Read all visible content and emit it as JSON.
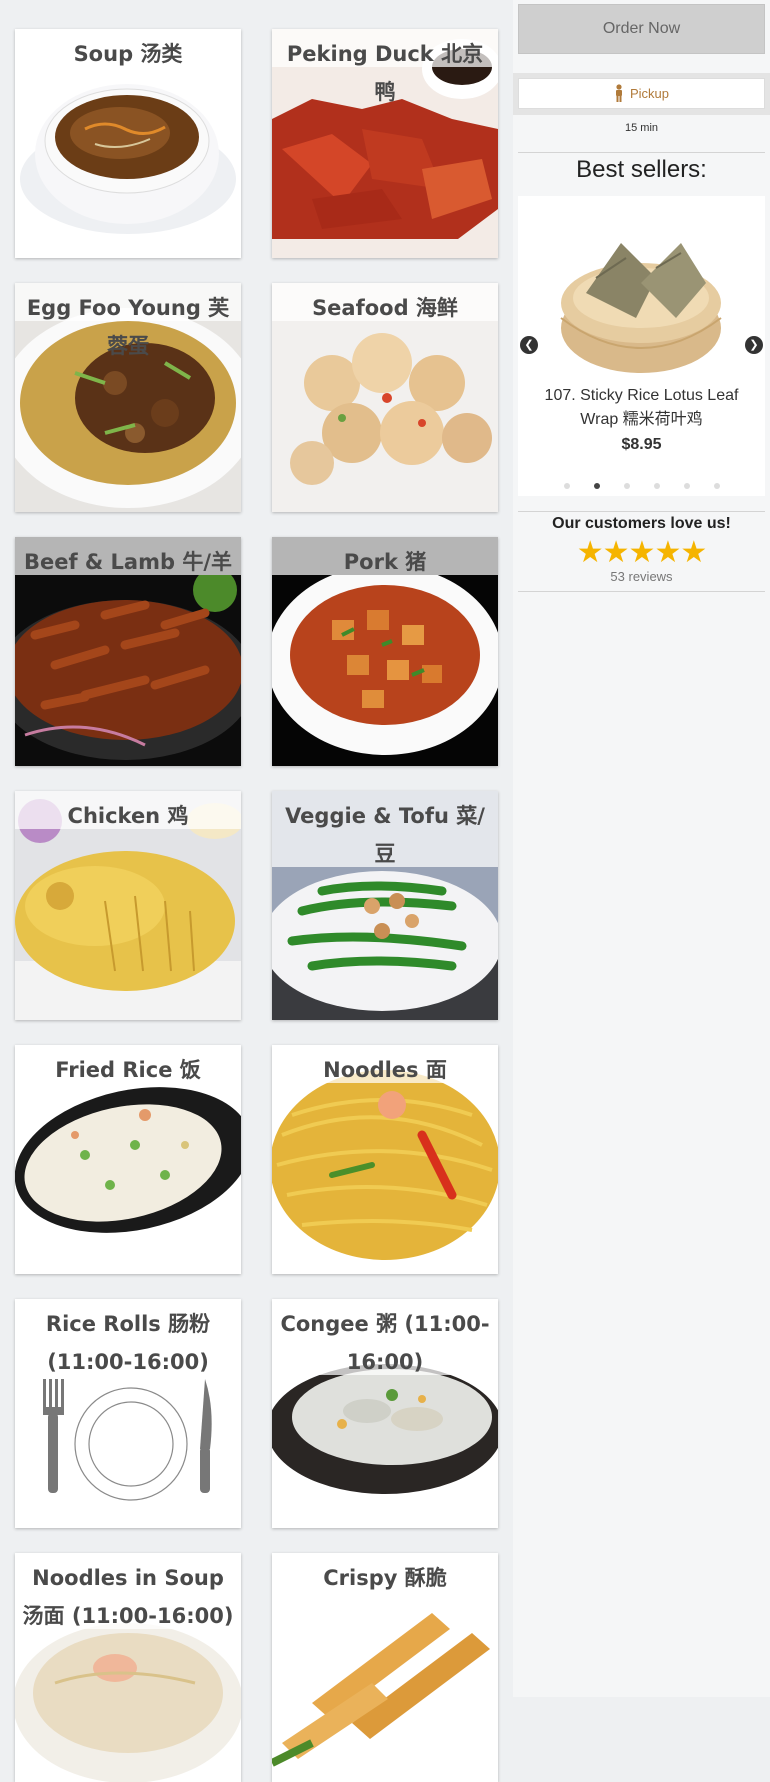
{
  "categories": [
    {
      "label": "Soup 汤类",
      "dark": false
    },
    {
      "label": "Peking Duck 北京鸭",
      "dark": false
    },
    {
      "label": "Egg Foo Young 芙蓉蛋",
      "dark": false
    },
    {
      "label": "Seafood 海鲜",
      "dark": false
    },
    {
      "label": "Beef & Lamb 牛/羊",
      "dark": true
    },
    {
      "label": "Pork 猪",
      "dark": true
    },
    {
      "label": "Chicken 鸡",
      "dark": false
    },
    {
      "label": "Veggie & Tofu 菜/ 豆",
      "dark": false
    },
    {
      "label": "Fried Rice 饭",
      "dark": false
    },
    {
      "label": "Noodles 面",
      "dark": false
    },
    {
      "label": "Rice Rolls 肠粉 (11:00-16:00)",
      "dark": false
    },
    {
      "label": "Congee 粥 (11:00-16:00)",
      "dark": false
    },
    {
      "label": "Noodles in Soup 汤面 (11:00-16:00)",
      "dark": false
    },
    {
      "label": "Crispy 酥脆",
      "dark": false
    }
  ],
  "sidebar": {
    "order_button": "Order Now",
    "mode_label": "Pickup",
    "eta": "15 min",
    "best_sellers_title": "Best sellers:",
    "best_seller_item": {
      "name": "107. Sticky Rice Lotus Leaf Wrap 糯米荷叶鸡",
      "price": "$8.95"
    },
    "slide_index": 2,
    "slide_count": 6,
    "love_title": "Our customers love us!",
    "rating": 5,
    "reviews": "53 reviews"
  },
  "colors": {
    "accent": "#b07a3a",
    "star": "#f5b400",
    "button": "#cfcfcf"
  },
  "icons": {
    "prev": "chevron-left-icon",
    "next": "chevron-right-icon",
    "mode": "person-icon"
  }
}
